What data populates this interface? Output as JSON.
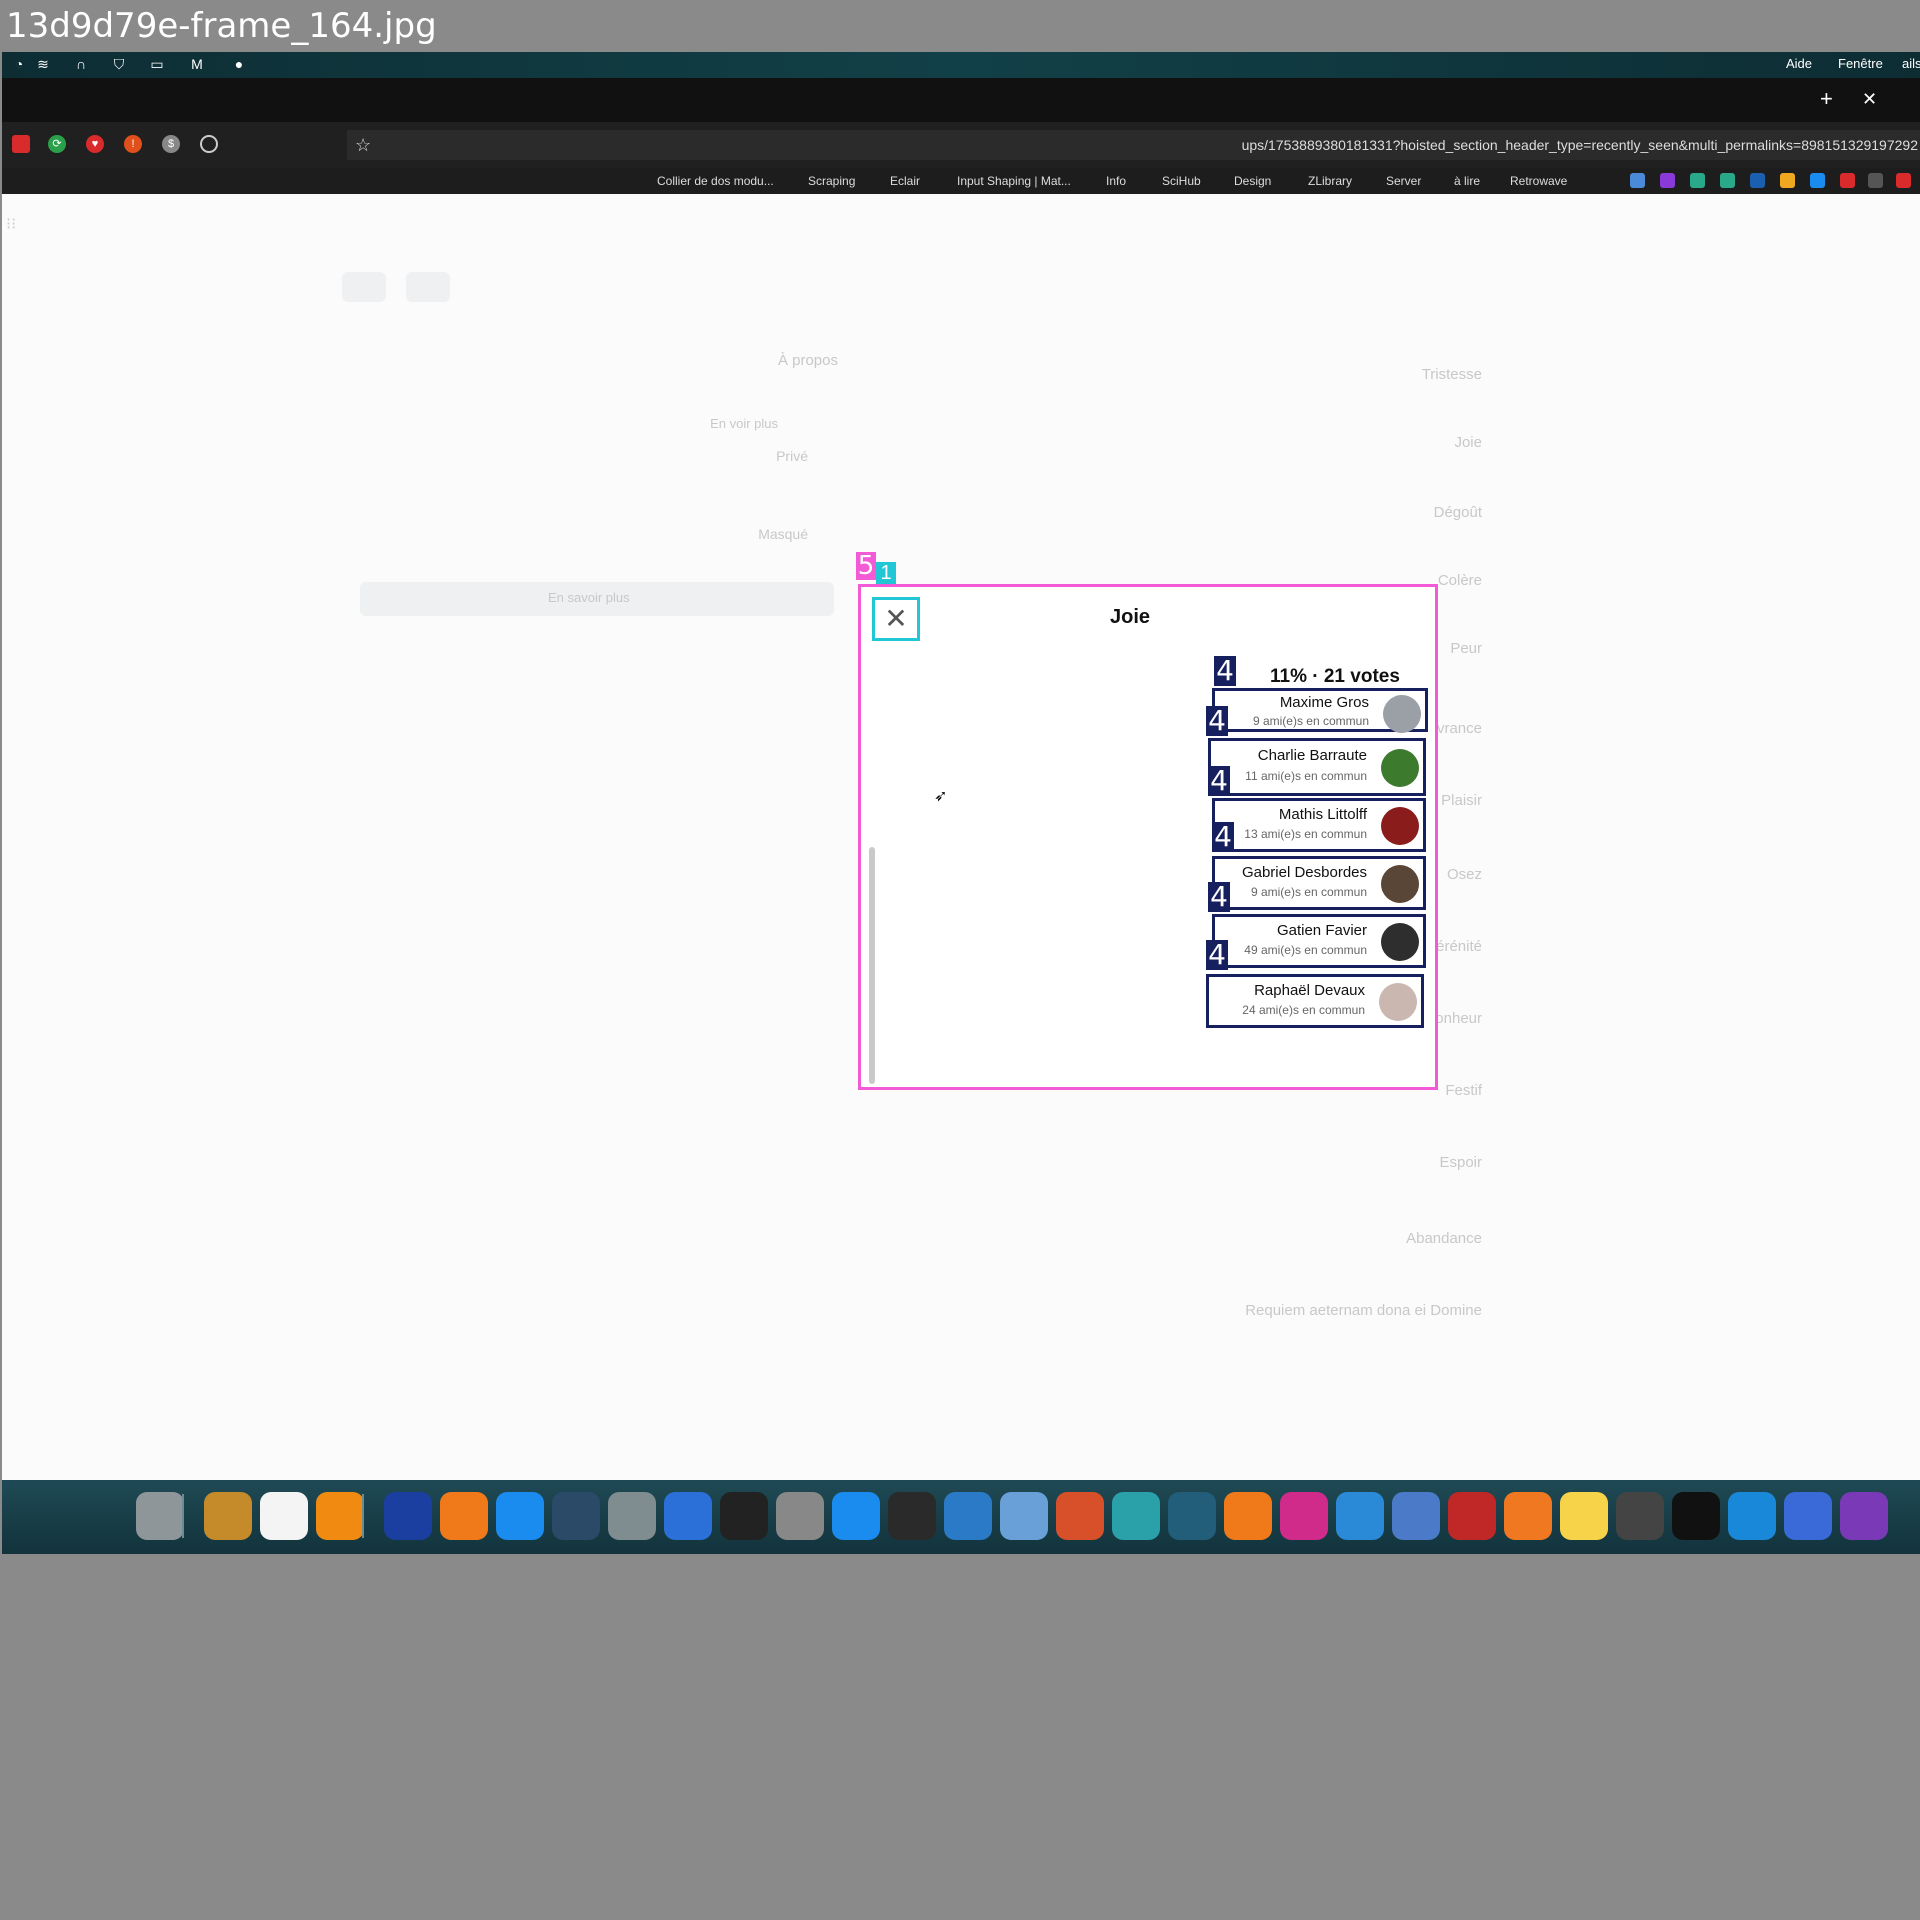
{
  "file_label": "13d9d79e-frame_164.jpg",
  "menubar": {
    "items": [
      "Aide",
      "Fenêtre",
      "ails"
    ]
  },
  "browser": {
    "url": "ups/1753889380181331?hoisted_section_header_type=recently_seen&multi_permalinks=898151329197292",
    "bookmarks": [
      "Retrowave",
      "à lire",
      "Server",
      "ZLibrary",
      "Design",
      "SciHub",
      "Info",
      "Input Shaping | Mat...",
      "Eclair",
      "Scraping",
      "Collier de dos modu..."
    ]
  },
  "background_page": {
    "options": [
      "Tristesse",
      "Joie",
      "Dégoût",
      "Colère",
      "Peur",
      "Délivrance",
      "Plaisir",
      "Osez",
      "Sérénité",
      "Bonheur",
      "Festif",
      "Espoir",
      "Abandance",
      "Requiem aeternam dona ei Domine"
    ],
    "sidebar": {
      "about_title": "À propos",
      "see_more": "En voir plus",
      "private": "Privé",
      "hidden": "Masqué",
      "learn_more": "En savoir plus"
    }
  },
  "modal": {
    "title": "Joie",
    "summary": "11% · 21 votes",
    "close_label": "✕",
    "voters": [
      {
        "name": "Maxime Gros",
        "mutual": "9 ami(e)s en commun",
        "avatar_color": "#9aa0a6"
      },
      {
        "name": "Charlie Barraute",
        "mutual": "11 ami(e)s en commun",
        "avatar_color": "#3c7a2d"
      },
      {
        "name": "Mathis Littolff",
        "mutual": "13 ami(e)s en commun",
        "avatar_color": "#8a1c1c"
      },
      {
        "name": "Gabriel Desbordes",
        "mutual": "9 ami(e)s en commun",
        "avatar_color": "#5a4636"
      },
      {
        "name": "Gatien Favier",
        "mutual": "49 ami(e)s en commun",
        "avatar_color": "#2e2e2e"
      },
      {
        "name": "Raphaël Devaux",
        "mutual": "24 ami(e)s en commun",
        "avatar_color": "#c9b7b0"
      }
    ]
  },
  "annotations": {
    "modal_label": "5",
    "close_label": "1",
    "voter_label": "4"
  },
  "dock": {
    "icons": [
      "trash-icon",
      "cider-icon",
      "textedit-icon",
      "vlc-icon",
      "dictionary-icon",
      "pages-icon",
      "appstore-icon",
      "steam-icon",
      "settings-icon",
      "word-icon",
      "activity-icon",
      "calculator-icon",
      "codeshot-icon",
      "terminal-icon",
      "xcode-icon",
      "rcode-icon",
      "matlab-icon",
      "arduino-icon",
      "sourcetree-icon",
      "sublime-icon",
      "intellij-icon",
      "vscode-icon",
      "preview-icon",
      "filezilla-icon",
      "firefox-icon",
      "notes-icon",
      "screenshot-icon",
      "sidenotes-icon",
      "nextcloud-icon",
      "launchpad-icon",
      "onenote-icon"
    ],
    "colors": [
      "#8f969a",
      "#c58a2a",
      "#f4f4f4",
      "#f08a10",
      "#1b3fa0",
      "#f07a1a",
      "#1a8cf0",
      "#2a4a68",
      "#7f8c90",
      "#2b6fd8",
      "#222",
      "#888",
      "#1a8cf0",
      "#2a2a2a",
      "#2a7ac8",
      "#6aa0d8",
      "#d8502a",
      "#2aa0a8",
      "#225d7a",
      "#f07a1a",
      "#d02a8a",
      "#2a8ad8",
      "#4a7ac8",
      "#c02828",
      "#f07820",
      "#f7d34a",
      "#444",
      "#111",
      "#1a88d8",
      "#3a6ad8",
      "#7a3ab8"
    ]
  }
}
